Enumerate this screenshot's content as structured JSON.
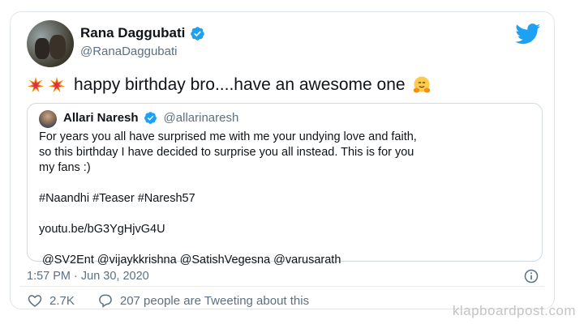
{
  "tweet": {
    "author_name": "Rana Daggubati",
    "author_handle": "@RanaDaggubati",
    "text": "happy birthday bro....have an awesome one",
    "timestamp": "1:57 PM · Jun 30, 2020",
    "likes": "2.7K",
    "tweeting_about": "207 people are Tweeting about this"
  },
  "quote": {
    "author_name": "Allari Naresh",
    "author_handle": "@allarinaresh",
    "lines": [
      "For years you all have surprised me with me your undying love and faith,",
      "so this birthday I have decided to surprise you all instead. This is for you",
      "my fans :)"
    ],
    "hashtags": "#Naandhi #Teaser #Naresh57",
    "link": "youtu.be/bG3YgHjvG4U",
    "mentions": "@SV2Ent @vijaykkrishna @SatishVegesna @varusarath"
  },
  "watermark": "klapboardpost.com",
  "colors": {
    "twitter_blue": "#1da1f2",
    "secondary_text": "#5b7083",
    "border": "#cfd9de"
  },
  "icons": [
    "collision-emoji",
    "hugging-face-emoji",
    "verified-badge-icon",
    "twitter-bird-icon",
    "info-icon",
    "heart-icon",
    "reply-bubble-icon"
  ]
}
